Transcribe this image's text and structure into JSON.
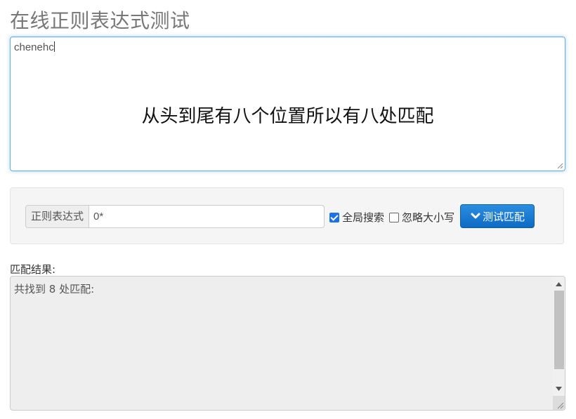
{
  "page": {
    "title": "在线正则表达式测试"
  },
  "input": {
    "text": "chenehc",
    "annotation": "从头到尾有八个位置所以有八处匹配"
  },
  "controls": {
    "regex_label": "正则表达式",
    "regex_value": "0*",
    "global_label": "全局搜索",
    "global_checked": true,
    "ignore_case_label": "忽略大小写",
    "ignore_case_checked": false,
    "test_button_label": "测试匹配"
  },
  "result": {
    "label": "匹配结果:",
    "text": "共找到 8 处匹配:"
  },
  "colors": {
    "accent": "#1a73e8",
    "button": "#0e6ac4"
  }
}
